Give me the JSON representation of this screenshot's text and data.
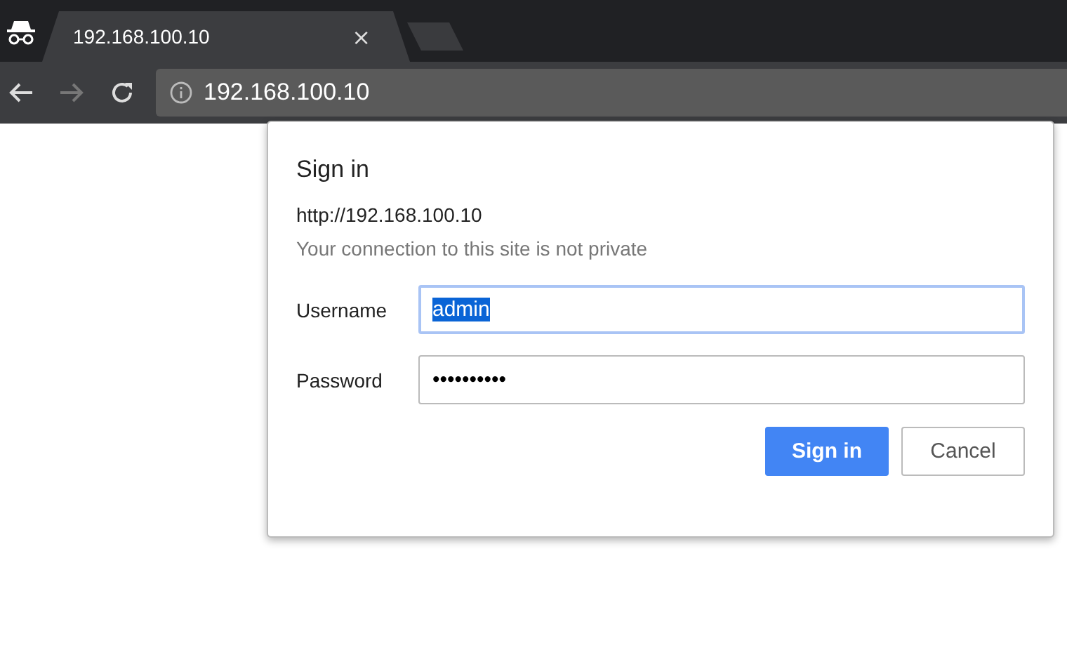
{
  "tab": {
    "title": "192.168.100.10",
    "close": "×",
    "incognito": true
  },
  "toolbar": {
    "back_disabled": false,
    "forward_disabled": true,
    "url": "192.168.100.10"
  },
  "dialog": {
    "title": "Sign in",
    "origin": "http://192.168.100.10",
    "warning": "Your connection to this site is not private",
    "fields": [
      {
        "label": "Username",
        "value": "admin",
        "focused": true,
        "text_selected": true
      },
      {
        "label": "Password",
        "value": "••••••••••",
        "focused": false,
        "text_selected": false
      }
    ],
    "buttons": [
      {
        "label": "Sign in",
        "kind": "primary"
      },
      {
        "label": "Cancel",
        "kind": "secondary"
      }
    ]
  }
}
